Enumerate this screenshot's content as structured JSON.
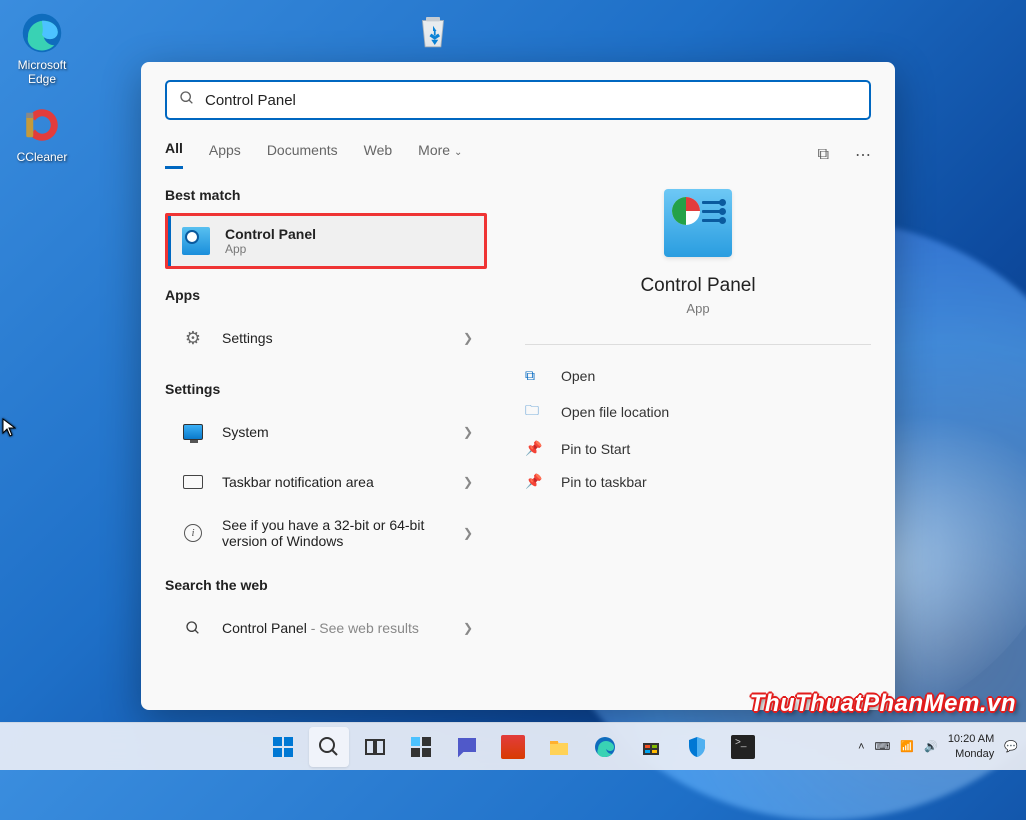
{
  "desktop": {
    "edge_label": "Microsoft Edge",
    "ccleaner_label": "CCleaner",
    "recycle_label": "Recycle Bin"
  },
  "search": {
    "query": "Control Panel",
    "tabs": {
      "all": "All",
      "apps": "Apps",
      "documents": "Documents",
      "web": "Web",
      "more": "More"
    },
    "sections": {
      "best_match": "Best match",
      "apps": "Apps",
      "settings": "Settings",
      "web": "Search the web"
    },
    "best": {
      "title": "Control Panel",
      "sub": "App"
    },
    "apps_list": {
      "settings": "Settings"
    },
    "settings_list": {
      "system": "System",
      "taskbar": "Taskbar notification area",
      "bits": "See if you have a 32-bit or 64-bit version of Windows"
    },
    "web_list": {
      "cp": "Control Panel",
      "cp_suffix": " - See web results"
    }
  },
  "preview": {
    "title": "Control Panel",
    "sub": "App",
    "actions": {
      "open": "Open",
      "location": "Open file location",
      "pin_start": "Pin to Start",
      "pin_taskbar": "Pin to taskbar"
    }
  },
  "tray": {
    "time": "10:20 AM",
    "day": "Monday"
  },
  "watermark": "ThuThuatPhanMem.vn"
}
